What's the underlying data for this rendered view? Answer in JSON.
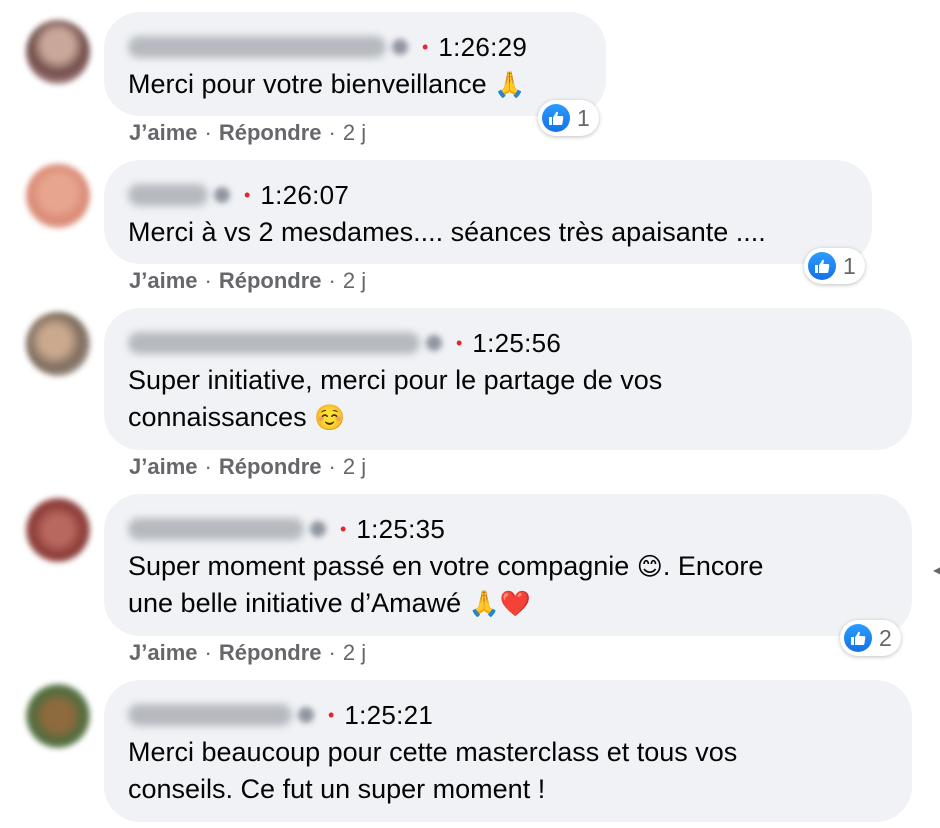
{
  "comments": [
    {
      "time": "1:26:29",
      "text": "Merci pour votre bienveillance",
      "emoji": "🙏",
      "reaction_count": "1"
    },
    {
      "time": "1:26:07",
      "text": "Merci à vs 2 mesdames.... séances très apaisante ....",
      "reaction_count": "1"
    },
    {
      "time": "1:25:56",
      "text_line1": "Super initiative, merci pour le partage de vos",
      "text_line2": "connaissances",
      "emoji": "☺️"
    },
    {
      "time": "1:25:35",
      "text_line1a": "Super moment passé en votre compagnie",
      "emoji1": "😊",
      "text_line1b": ". Encore",
      "text_line2": "une belle initiative d’Amawé",
      "emoji2": "🙏❤️",
      "reaction_count": "2"
    },
    {
      "time": "1:25:21",
      "text_line1": "Merci beaucoup pour cette masterclass et tous vos",
      "text_line2": "conseils. Ce fut un super moment !"
    }
  ],
  "actions": {
    "like": "J’aime",
    "reply": "Répondre",
    "age": "2 j",
    "separator": "·"
  },
  "colors": {
    "bubble": "#f0f2f5",
    "like_blue": "#1877f2",
    "meta_gray": "#65676b",
    "dot_red": "#e4262c"
  },
  "icons": {
    "reaction": "like-thumbs-up-icon",
    "verified": "verified-badge-icon"
  }
}
